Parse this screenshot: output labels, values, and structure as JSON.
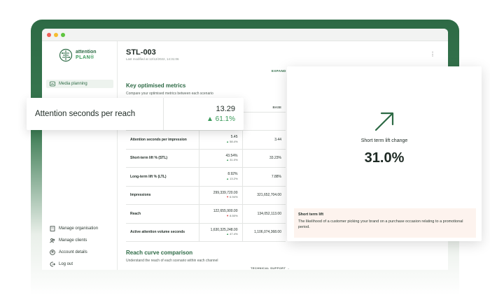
{
  "brand": {
    "name_top": "attention",
    "name_bottom": "PLAN®",
    "accent": "#2d6a45"
  },
  "sidebar": {
    "top_items": [
      {
        "label": "Media planning",
        "icon": "media-planning-icon",
        "active": true
      }
    ],
    "bottom_items": [
      {
        "label": "Manage organisation",
        "icon": "building-icon"
      },
      {
        "label": "Manage clients",
        "icon": "clients-icon"
      },
      {
        "label": "Account details",
        "icon": "user-icon"
      },
      {
        "label": "Log out",
        "icon": "logout-icon"
      }
    ]
  },
  "header": {
    "title": "STL-003",
    "last_modified": "Last modified at 12/12/2022, 14:31:06",
    "expand": "EXPAND"
  },
  "key_metrics": {
    "title": "Key optimised metrics",
    "subtitle": "Compare your optimised metrics between each scenario",
    "base_header": "BASE",
    "rows": [
      {
        "name": "Attention seconds per impression",
        "value": "5.45",
        "change": "58.4%",
        "dir": "up",
        "base": "3.44"
      },
      {
        "name": "Short-term lift % (STL)",
        "value": "43.54%",
        "change": "31.0%",
        "dir": "up",
        "base": "33.23%"
      },
      {
        "name": "Long-term lift % (LTL)",
        "value": "8.92%",
        "change": "13.2%",
        "dir": "up",
        "base": "7.88%"
      },
      {
        "name": "Impressions",
        "value": "299,339,720.00",
        "change": "6.94%",
        "dir": "down",
        "base": "321,652,704.00"
      },
      {
        "name": "Reach",
        "value": "122,655,900.00",
        "change": "8.50%",
        "dir": "down",
        "base": "134,052,113.00"
      },
      {
        "name": "Active attention volume seconds",
        "value": "1,630,325,248.00",
        "change": "47.4%",
        "dir": "up",
        "base": "1,106,074,368.00"
      }
    ]
  },
  "reach_curve": {
    "title": "Reach curve comparison",
    "subtitle": "Understand the reach of each scenario within each channel"
  },
  "support": "TECHNICAL SUPPORT →",
  "callout": {
    "label": "Attention seconds per reach",
    "value": "13.29",
    "change": "61.1%"
  },
  "lift_card": {
    "title": "Short term lift change",
    "value": "31.0%",
    "note_title": "Short term lift",
    "note_text": "The likelihood of a customer picking your brand on a purchase occasion relating to a promotional period."
  }
}
